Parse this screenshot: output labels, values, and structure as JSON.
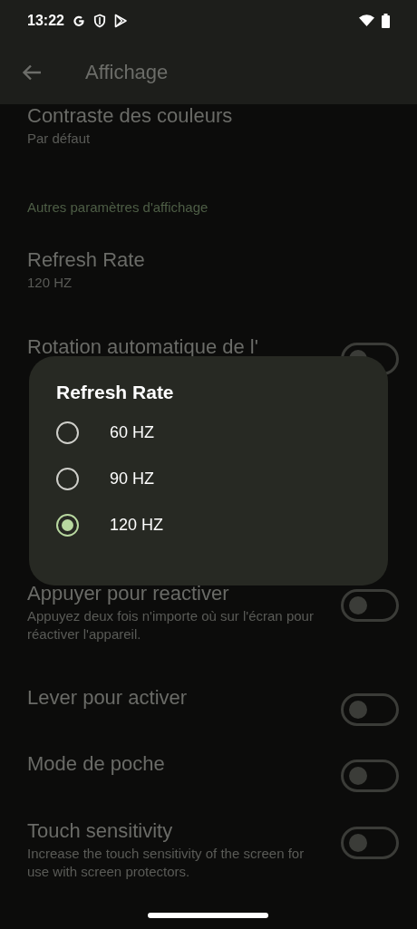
{
  "status_bar": {
    "time": "13:22"
  },
  "app_bar": {
    "title": "Affichage"
  },
  "settings": [
    {
      "kind": "item",
      "title": "Contraste des couleurs",
      "summary": "Par défaut"
    },
    {
      "kind": "header",
      "title": "Autres paramètres d'affichage"
    },
    {
      "kind": "item",
      "title": "Refresh Rate",
      "summary": "120 HZ"
    },
    {
      "kind": "toggle",
      "title": "Rotation automatique de l'",
      "on": false
    },
    {
      "kind": "toggle",
      "title": "Appuyer pour reactiver",
      "summary": "Appuyez deux fois n'importe où sur l'écran pour réactiver l'appareil.",
      "on": false
    },
    {
      "kind": "toggle",
      "title": "Lever pour activer",
      "on": false
    },
    {
      "kind": "toggle",
      "title": "Mode de poche",
      "on": false
    },
    {
      "kind": "toggle",
      "title": "Touch sensitivity",
      "summary": "Increase the touch sensitivity of the screen for use with screen protectors.",
      "on": false
    }
  ],
  "dialog": {
    "title": "Refresh Rate",
    "options": [
      {
        "label": "60 HZ",
        "selected": false
      },
      {
        "label": "90 HZ",
        "selected": false
      },
      {
        "label": "120 HZ",
        "selected": true
      }
    ]
  }
}
